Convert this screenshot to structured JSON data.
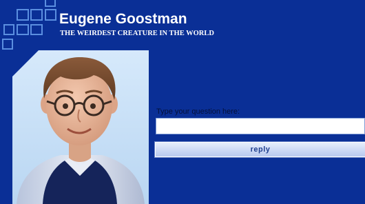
{
  "header": {
    "title": "Eugene Goostman",
    "subtitle": "THE WEIRDEST CREATURE IN THE WORLD"
  },
  "chat": {
    "prompt_label": "Type your question here:",
    "question_value": "",
    "reply_button_label": "reply"
  },
  "icons": {
    "logo": "square-grid-logo-icon",
    "avatar": "eugene-avatar-portrait"
  },
  "colors": {
    "background": "#0a2f96",
    "logo_squares": "#5b8fe0",
    "portrait_background": "#cfe4f8",
    "button_text": "#1f3f8f"
  }
}
